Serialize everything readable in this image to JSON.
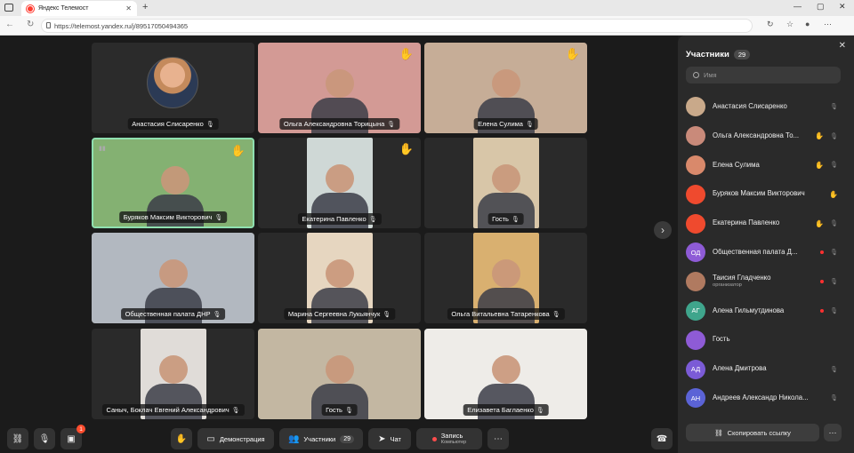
{
  "browser": {
    "tab_title": "Яндекс Телемост",
    "tab_close": "✕",
    "new_tab": "+",
    "url": "https://telemost.yandex.ru/j/89517050494365",
    "window_min": "—",
    "window_max": "▢",
    "window_close": "✕"
  },
  "tiles": [
    {
      "name": "Анастасия Слисаренко",
      "hand": false,
      "type": "avatar"
    },
    {
      "name": "Ольга Александровна Торицына",
      "hand": true,
      "type": "video",
      "bg": "#b98d6a",
      "photo": "#e9a6b8"
    },
    {
      "name": "Елена Сулима",
      "hand": true,
      "type": "video",
      "bg": "#b09078",
      "photo": "#d8c4b0"
    },
    {
      "name": "Буряков Максим Викторович",
      "hand": true,
      "type": "video",
      "bg": "#8b8175",
      "photo": "#7fd86f",
      "active": true
    },
    {
      "name": "Екатерина Павленко",
      "hand": true,
      "type": "video",
      "bg": "#2a2a2a",
      "photo": "#cfd8d6"
    },
    {
      "name": "Гость",
      "hand": false,
      "type": "video",
      "bg": "#2a2a2a",
      "photo": "#d8c6a8"
    },
    {
      "name": "Общественная палата ДНР",
      "hand": false,
      "type": "video",
      "bg": "#9a9690",
      "photo": "#c7d6e8"
    },
    {
      "name": "Марина Сергеевна Лукьянчук",
      "hand": false,
      "type": "video",
      "bg": "#2a2a2a",
      "photo": "#e6d6c0"
    },
    {
      "name": "Ольга Витальевна Татаренкова",
      "hand": false,
      "type": "video",
      "bg": "#2a2a2a",
      "photo": "#d9b070"
    },
    {
      "name": "Саныч, Боклач Евгений Александрович",
      "hand": false,
      "type": "video",
      "bg": "#2a2a2a",
      "photo": "#e0dcd8"
    },
    {
      "name": "Гость",
      "hand": false,
      "type": "video",
      "bg": "#cfc9b8",
      "photo": "#b9a890"
    },
    {
      "name": "Елизавета Баглаенко",
      "hand": false,
      "type": "video",
      "bg": "#e8e8e8",
      "photo": "#f2eee8"
    }
  ],
  "toolbar": {
    "demo_label": "Демонстрация",
    "participants_label": "Участники",
    "participants_count": "29",
    "chat_label": "Чат",
    "record_label": "Запись",
    "record_sub": "Компьютер",
    "notif_count": "1"
  },
  "panel": {
    "title": "Участники",
    "count": "29",
    "search_placeholder": "Имя",
    "copy_label": "Скопировать ссылку",
    "participants": [
      {
        "name": "Анастасия Слисаренко",
        "initials": "",
        "color": "#c9a98a",
        "hand": false,
        "dot": false,
        "muted": true
      },
      {
        "name": "Ольга Александровна То...",
        "initials": "",
        "color": "#c98a7a",
        "hand": true,
        "dot": false,
        "muted": true
      },
      {
        "name": "Елена Сулима",
        "initials": "",
        "color": "#d9896b",
        "hand": true,
        "dot": false,
        "muted": true
      },
      {
        "name": "Буряков Максим Викторович",
        "initials": "",
        "color": "#ef4a2e",
        "hand": true,
        "dot": false,
        "muted": false
      },
      {
        "name": "Екатерина Павленко",
        "initials": "",
        "color": "#ef4a2e",
        "hand": true,
        "dot": false,
        "muted": true
      },
      {
        "name": "Общественная палата Д...",
        "initials": "ОД",
        "color": "#8e5bd6",
        "hand": false,
        "dot": true,
        "muted": true
      },
      {
        "name": "Таисия Гладченко",
        "role": "организатор",
        "initials": "",
        "color": "#b07a60",
        "hand": false,
        "dot": true,
        "muted": true
      },
      {
        "name": "Алена Гильмутдинова",
        "initials": "АГ",
        "color": "#3fa58c",
        "hand": false,
        "dot": true,
        "muted": true
      },
      {
        "name": "Гость",
        "initials": "",
        "color": "#8e5bd6",
        "hand": false,
        "dot": false,
        "muted": false
      },
      {
        "name": "Алена Дмитрова",
        "initials": "АД",
        "color": "#7b5bd6",
        "hand": false,
        "dot": false,
        "muted": true
      },
      {
        "name": "Андреев Александр Никола...",
        "initials": "АН",
        "color": "#5b63d6",
        "hand": false,
        "dot": false,
        "muted": true
      }
    ]
  }
}
